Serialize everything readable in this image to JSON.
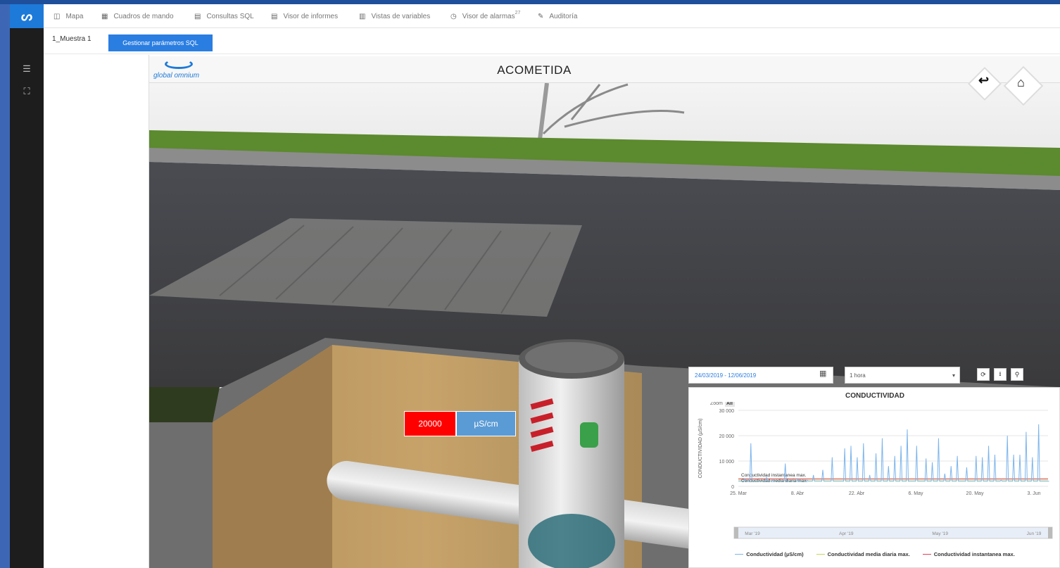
{
  "app": {
    "logo_glyph": "ᔕ"
  },
  "menu": {
    "items": [
      {
        "label": "Mapa",
        "icon": "map-icon"
      },
      {
        "label": "Cuadros de mando",
        "icon": "dashboard-icon"
      },
      {
        "label": "Consultas SQL",
        "icon": "database-icon"
      },
      {
        "label": "Visor de informes",
        "icon": "report-icon"
      },
      {
        "label": "Vistas de variables",
        "icon": "bar-chart-icon"
      },
      {
        "label": "Visor de alarmas",
        "icon": "clock-icon",
        "badge": "27"
      },
      {
        "label": "Auditoría",
        "icon": "edit-icon"
      }
    ]
  },
  "tabs": {
    "active_tab": "1_Muestra 1",
    "manage_button": "Gestionar parámetros SQL"
  },
  "scene": {
    "title": "ACOMETIDA",
    "brand": "global omnium",
    "value": "20000",
    "unit": "µS/cm"
  },
  "chart_controls": {
    "date_range": "24/03/2019 - 12/06/2019",
    "interval": "1 hora"
  },
  "chart_data": {
    "type": "line",
    "title": "CONDUCTIVIDAD",
    "ylabel": "CONDUCTIVIDAD (µS/cm)",
    "zoom_label": "Zoom",
    "zoom_option": "All",
    "ylim": [
      0,
      30000
    ],
    "y_ticks": [
      "0",
      "10 000",
      "20 000",
      "30 000"
    ],
    "x_ticks": [
      "25. Mar",
      "8. Abr",
      "22. Abr",
      "6. May",
      "20. May",
      "3. Jun"
    ],
    "navigator_labels": [
      "Mar '19",
      "Apr '19",
      "May '19",
      "Jun '19"
    ],
    "annotations": [
      "Conductividad instantanea max.",
      "Conductividad media diaria max."
    ],
    "thresholds": {
      "media_diaria_max": 2500,
      "instantanea_max": 3000
    },
    "series": [
      {
        "name": "Conductividad (µS/cm)",
        "color": "#7cb5ec",
        "peaks_x": [
          2,
          4,
          7,
          9,
          11,
          15,
          17,
          19,
          22,
          24,
          27,
          30,
          34,
          36,
          38,
          40,
          42,
          44,
          46,
          48,
          50,
          52,
          54,
          57,
          60,
          62,
          64,
          66,
          68,
          70,
          73,
          76,
          78,
          80,
          82,
          84,
          86,
          88,
          90,
          92,
          94,
          96
        ],
        "peaks_y": [
          3000,
          17000,
          2000,
          3500,
          2500,
          9000,
          2000,
          3000,
          2500,
          4500,
          6500,
          11500,
          15000,
          16000,
          11500,
          17000,
          4500,
          13000,
          19000,
          8000,
          12000,
          16000,
          22500,
          16000,
          11000,
          9500,
          19000,
          5000,
          8000,
          12000,
          7500,
          12000,
          11500,
          16000,
          12500,
          2500,
          20000,
          12500,
          12500,
          21500,
          11500,
          24500
        ]
      },
      {
        "name": "Conductividad media diaria max.",
        "color": "#c8d85a"
      },
      {
        "name": "Conductividad instantanea max.",
        "color": "#e0405a"
      }
    ]
  }
}
